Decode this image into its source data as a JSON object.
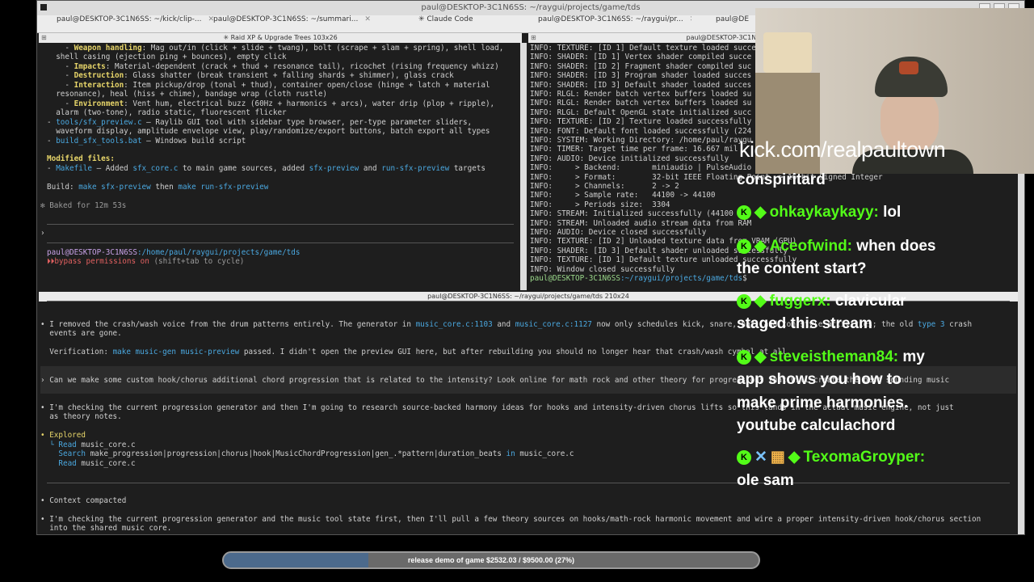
{
  "window": {
    "title": "paul@DESKTOP-3C1N6SS: ~/raygui/projects/game/tds"
  },
  "tabs": [
    {
      "label": "paul@DESKTOP-3C1N6SS: ~/kick/clip-..."
    },
    {
      "label": "paul@DESKTOP-3C1N6SS: ~/summari..."
    },
    {
      "label": "✳ Claude Code"
    },
    {
      "label": "paul@DESKTOP-3C1N6SS: ~/raygui/pr..."
    },
    {
      "label": "paul@DE"
    }
  ],
  "pane_left": {
    "header": "✳ Raid XP & Upgrade Trees 103x26",
    "lines": [
      {
        "a": "    - ",
        "b": "Weapon handling",
        "c": ": Mag out/in (click + slide + twang), bolt (scrape + slam + spring), shell load,"
      },
      {
        "a": "  shell casing (ejection ping + bounces), empty click"
      },
      {
        "a": "    - ",
        "b": "Impacts",
        "c": ": Material-dependent (crack + thud + resonance tail), ricochet (rising frequency whizz)"
      },
      {
        "a": "    - ",
        "b": "Destruction",
        "c": ": Glass shatter (break transient + falling shards + shimmer), glass crack"
      },
      {
        "a": "    - ",
        "b": "Interaction",
        "c": ": Item pickup/drop (tonal + thud), container open/close (hinge + latch + material"
      },
      {
        "a": "  resonance), heal (hiss + chime), bandage wrap (cloth rustle)"
      },
      {
        "a": "    - ",
        "b": "Environment",
        "c": ": Vent hum, electrical buzz (60Hz + harmonics + arcs), water drip (plop + ripple),"
      },
      {
        "a": "  alarm (two-tone), radio static, fluorescent flicker"
      }
    ],
    "tool1_file": "tools/sfx_preview.c",
    "tool1_desc": " — Raylib GUI tool with sidebar type browser, per-type parameter sliders,",
    "tool1_cont": "  waveform display, amplitude envelope view, play/randomize/export buttons, batch export all types",
    "tool2_file": "build_sfx_tools.bat",
    "tool2_desc": " — Windows build script",
    "modified_title": "Modified files:",
    "mod_file": "Makefile",
    "mod_a": " — Added ",
    "mod_b": "sfx_core.c",
    "mod_c": " to main game sources, added ",
    "mod_d": "sfx-preview",
    "mod_e": " and ",
    "mod_f": "run-sfx-preview",
    "mod_g": " targets",
    "build_a": "Build: ",
    "build_b": "make sfx-preview",
    "build_c": " then ",
    "build_d": "make run-sfx-preview",
    "baked": "✻ Baked for 12m 53s",
    "prompt_char": "›",
    "path_user": "paul@DESKTOP-3C1N6SS",
    "path_dir": ":/home/paul/raygui/projects/game/tds",
    "bypass_icon": "⏵⏵",
    "bypass_a": "bypass permissions on",
    "bypass_b": " (shift+tab to cycle)"
  },
  "pane_right": {
    "lines": [
      "INFO: TEXTURE: [ID 1] Default texture loaded succe",
      "INFO: SHADER: [ID 1] Vertex shader compiled succe",
      "INFO: SHADER: [ID 2] Fragment shader compiled suc",
      "INFO: SHADER: [ID 3] Program shader loaded succes",
      "INFO: SHADER: [ID 3] Default shader loaded succes",
      "INFO: RLGL: Render batch vertex buffers loaded su",
      "INFO: RLGL: Render batch vertex buffers loaded su",
      "INFO: RLGL: Default OpenGL state initialized succ",
      "INFO: TEXTURE: [ID 2] Texture loaded successfully",
      "INFO: FONT: Default font loaded successfully (224",
      "INFO: SYSTEM: Working Directory: /home/paul/raygu",
      "INFO: TIMER: Target time per frame: 16.667 mil",
      "INFO: AUDIO: Device initialized successfully",
      "INFO:     > Backend:       miniaudio | PulseAudio",
      "INFO:     > Format:        32-bit IEEE Floating Point -> 16-bit Signed Integer",
      "INFO:     > Channels:      2 -> 2",
      "INFO:     > Sample rate:   44100 -> 44100",
      "INFO:     > Periods size:  3304",
      "INFO: STREAM: Initialized successfully (44100",
      "INFO: STREAM: Unloaded audio stream data from RAM",
      "INFO: AUDIO: Device closed successfully",
      "INFO: TEXTURE: [ID 2] Unloaded texture data from VRAM (GPU)",
      "INFO: SHADER: [ID 3] Default shader unloaded successfully",
      "INFO: TEXTURE: [ID 1] Default texture unloaded successfully",
      "INFO: Window closed successfully"
    ],
    "prompt_user": "paul@DESKTOP-3C1N6SS",
    "prompt_dir": ":~/raygui/projects/game/tds",
    "prompt_end": "$ "
  },
  "pane_bottom": {
    "header": "paul@DESKTOP-3C1N6SS: ~/raygui/projects/game/tds 210x24",
    "l1_a": "• I removed the crash/wash voice from the drum patterns entirely. The generator in ",
    "l1_b": "music_core.c:1103",
    "l1_c": " and ",
    "l1_d": "music_core.c:1127",
    "l1_e": " now only schedules kick, snare, hat, and tom-style activities; the old ",
    "l1_f": "type 3",
    "l1_g": " crash",
    "l2": "  events are gone.",
    "l3_a": "  Verification: ",
    "l3_b": "make music-gen music-preview",
    "l3_c": " passed. I didn't open the preview GUI here, but after rebuilding you should no longer hear that crash/wash cymbal at all.",
    "l4": "› Can we make some custom hook/chorus additional chord progression that is related to the intensity? Look online for math rock and other theory for progressions that will create the best sounding music",
    "l5": "• I'm checking the current progression generator and then I'm going to research source-backed harmony ideas for hooks and intensity-driven chorus lifts so this lands in the actual music engine, not just",
    "l6": "  as theory notes.",
    "explored": "• Explored",
    "ex1_a": "  └ Read ",
    "ex1_b": "music_core.c",
    "ex2_a": "    Search ",
    "ex2_b": "make_progression|progression|chorus|hook|MusicChordProgression|gen_.*pattern|duration_beats",
    "ex2_c": " in ",
    "ex2_d": "music_core.c",
    "ex3_a": "    Read ",
    "ex3_b": "music_core.c",
    "compacted": "• Context compacted",
    "l7": "• I'm checking the current progression generator and the music tool state first, then I'll pull a few theory sources on hooks/math-rock harmonic movement and wire a proper intensity-driven hook/chorus section",
    "l8": "  into the shared music core."
  },
  "overlay": {
    "kick_url": "kick.com/realpaultown",
    "chat": [
      {
        "user": "",
        "text": "conspiritard",
        "badges": ""
      },
      {
        "user": "ohkaykaykayy:",
        "text": "lol",
        "badges": "K◆"
      },
      {
        "user": "Aceofwind:",
        "text": "when does",
        "badges": "K◆",
        "cont": "the content start?"
      },
      {
        "user": "fuggerx:",
        "text": "clavicular",
        "badges": "K◆",
        "cont": "staged this stream"
      },
      {
        "user": "steveistheman84:",
        "text": "my",
        "badges": "K◆",
        "cont": "app shows you how to",
        "cont2": "make prime harmonies.",
        "cont3": "youtube calculachord"
      },
      {
        "user": "TexomaGroyper:",
        "text": "",
        "badges": "K✕▦◆",
        "cont": "ole sam"
      }
    ],
    "goal_label": "release demo of game $2532.03 / $9500.00 (27%)",
    "goal_fraction": 0.27
  }
}
